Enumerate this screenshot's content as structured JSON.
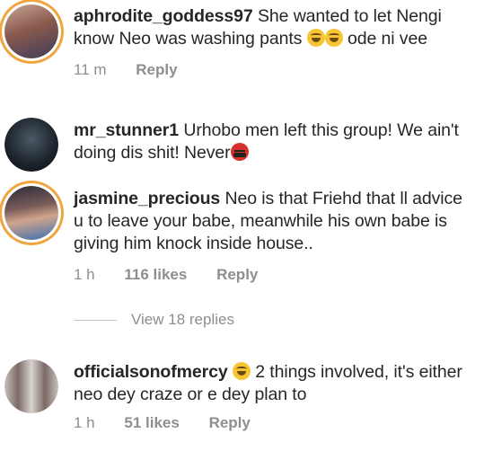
{
  "comments": [
    {
      "username": "aphrodite_goddess97",
      "text_before": "She wanted to let Nengi know Neo was washing pants",
      "emoji": [
        "laughing-emoji",
        "laughing-emoji"
      ],
      "text_after": "ode ni vee",
      "time": "11 m",
      "likes": "",
      "reply": "Reply"
    },
    {
      "username": "mr_stunner1",
      "text_before": "Urhobo men left this group! We ain't doing dis shit! Never",
      "emoji": [
        "angry-emoji"
      ],
      "text_after": "",
      "time": "",
      "likes": "",
      "reply": ""
    },
    {
      "username": "jasmine_precious",
      "text_before": "Neo is that Friehd that ll advice u to leave your babe, meanwhile his own babe is giving him knock inside house..",
      "emoji": [],
      "text_after": "",
      "time": "1 h",
      "likes": "116 likes",
      "reply": "Reply"
    },
    {
      "username": "officialsonofmercy",
      "text_before": "",
      "emoji": [
        "laughing-emoji"
      ],
      "text_after": "2 things involved, it's either neo dey craze or e dey plan to",
      "time": "1 h",
      "likes": "51 likes",
      "reply": "Reply"
    }
  ],
  "view_replies": "View 18 replies",
  "colors": {
    "story_ring": "#f0a53f",
    "meta_text": "#8e8e8e",
    "text": "#262626"
  }
}
